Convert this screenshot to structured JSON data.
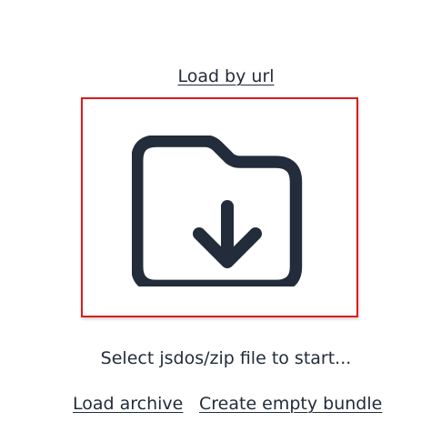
{
  "links": {
    "load_by_url": "Load by url",
    "load_archive": "Load archive",
    "create_empty_bundle": "Create empty bundle"
  },
  "drop_zone": {
    "icon": "folder-download-icon",
    "border_color": "#dd1c1c",
    "icon_color": "#222c3a"
  },
  "status_text": "Select jsdos/zip file to start..."
}
